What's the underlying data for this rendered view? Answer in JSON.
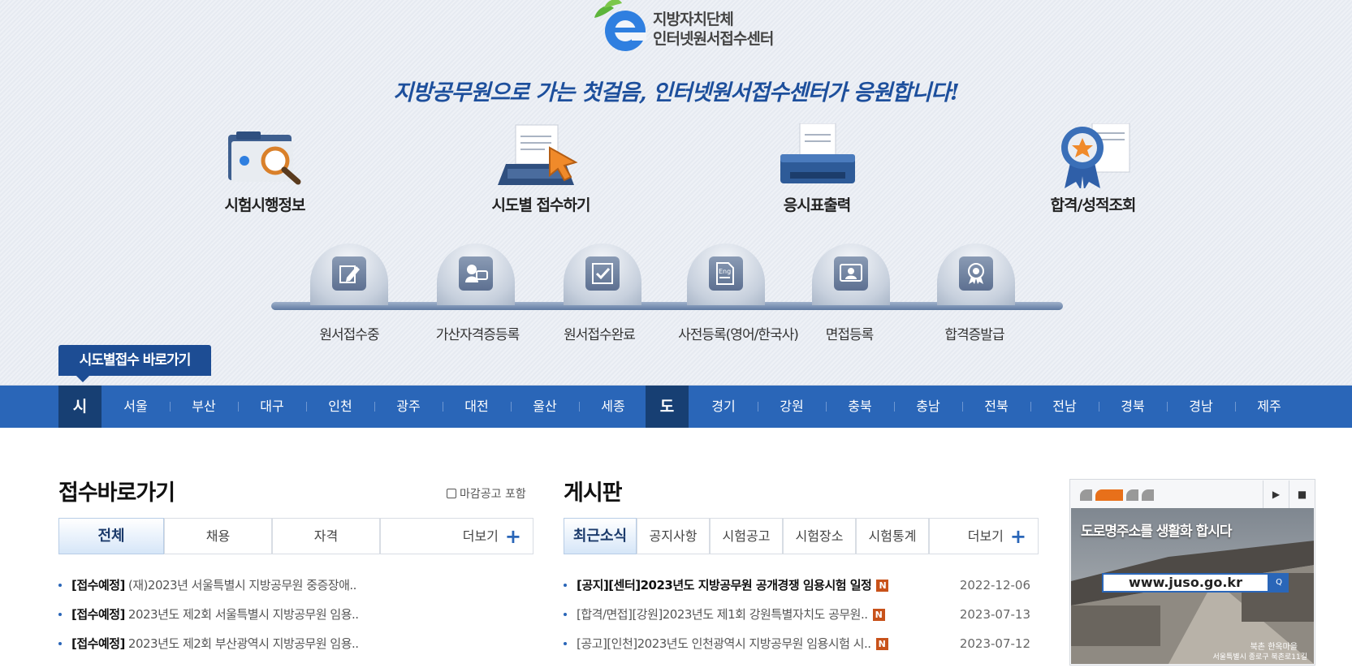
{
  "logo": {
    "line1": "지방자치단체",
    "line2": "인터넷원서접수센터"
  },
  "slogan": "지방공무원으로 가는 첫걸음, 인터넷원서접수센터가 응원합니다!",
  "main_menu": [
    "시험시행정보",
    "시도별 접수하기",
    "응시표출력",
    "합격/성적조회"
  ],
  "steps": [
    "원서접수중",
    "가산자격증등록",
    "원서접수완료",
    "사전등록(영어/한국사)",
    "면접등록",
    "합격증발급"
  ],
  "shortcut_label": "시도별접수 바로가기",
  "region_nav": {
    "si_label": "시",
    "si": [
      "서울",
      "부산",
      "대구",
      "인천",
      "광주",
      "대전",
      "울산",
      "세종"
    ],
    "do_label": "도",
    "do": [
      "경기",
      "강원",
      "충북",
      "충남",
      "전북",
      "전남",
      "경북",
      "경남",
      "제주"
    ]
  },
  "apply_section": {
    "title": "접수바로가기",
    "checkbox_label": "마감공고 포함",
    "tabs": [
      "전체",
      "채용",
      "자격"
    ],
    "more_label": "더보기",
    "items": [
      {
        "tag": "[접수예정]",
        "text": "(재)2023년 서울특별시 지방공무원 중증장애.."
      },
      {
        "tag": "[접수예정]",
        "text": "2023년도 제2회 서울특별시 지방공무원 임용.."
      },
      {
        "tag": "[접수예정]",
        "text": "2023년도 제2회 부산광역시 지방공무원 임용.."
      }
    ]
  },
  "board_section": {
    "title": "게시판",
    "tabs": [
      "최근소식",
      "공지사항",
      "시험공고",
      "시험장소",
      "시험통계"
    ],
    "more_label": "더보기",
    "new_badge": "N",
    "items": [
      {
        "text": "[공지][센터]2023년도 지방공무원 공개경쟁 임용시험 일정",
        "date": "2022-12-06",
        "bold": true
      },
      {
        "text": "[합격/면접][강원]2023년도 제1회 강원특별자치도 공무원..",
        "date": "2023-07-13",
        "bold": false
      },
      {
        "text": "[공고][인천]2023년도 인천광역시 지방공무원 임용시험 시..",
        "date": "2023-07-12",
        "bold": false
      }
    ]
  },
  "banner": {
    "title": "도로명주소를 생활화 합시다",
    "url": "www.juso.go.kr",
    "caption1": "북촌 한옥마을",
    "caption2": "서울특별시 종로구 북촌로11길",
    "play_icon": "▶",
    "stop_icon": "■"
  },
  "colors": {
    "primary": "#2a66b8",
    "dark": "#173f73",
    "accent": "#e8701a",
    "badge": "#c8521a"
  }
}
